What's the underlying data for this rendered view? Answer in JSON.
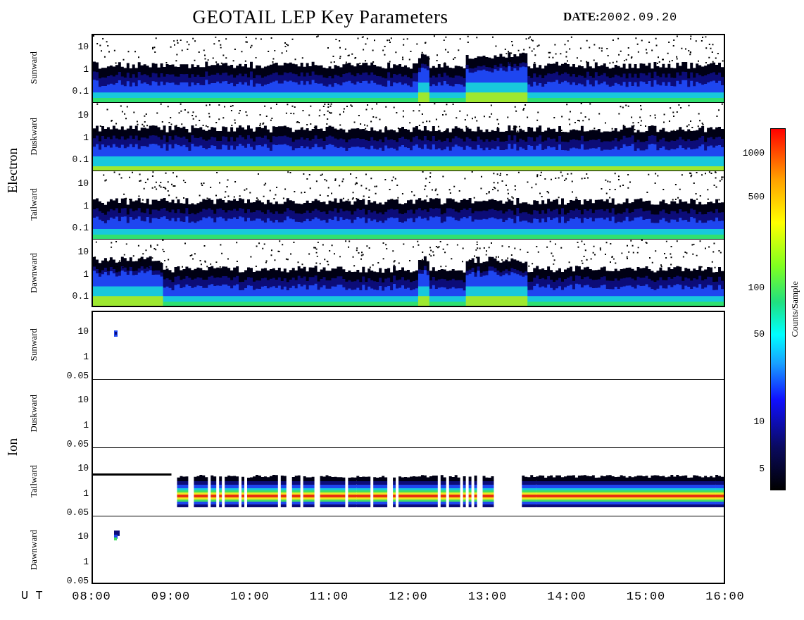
{
  "title": "GEOTAIL LEP Key Parameters",
  "date": {
    "label": "DATE:",
    "value": "2002.09.20"
  },
  "groups": [
    {
      "label": "Electron",
      "panels": [
        {
          "label": "Sunward",
          "kind": "dense",
          "yticks": [
            "10",
            "1",
            "0.1"
          ]
        },
        {
          "label": "Duskward",
          "kind": "dense",
          "yticks": [
            "10",
            "1",
            "0.1"
          ]
        },
        {
          "label": "Tailward",
          "kind": "dense",
          "yticks": [
            "10",
            "1",
            "0.1"
          ]
        },
        {
          "label": "Dawnward",
          "kind": "dense",
          "yticks": [
            "10",
            "1",
            "0.1"
          ]
        }
      ]
    },
    {
      "label": "Ion",
      "panels": [
        {
          "label": "Sunward",
          "kind": "blob",
          "yticks": [
            "10",
            "1",
            "0.05"
          ]
        },
        {
          "label": "Duskward",
          "kind": "empty",
          "yticks": [
            "10",
            "1",
            "0.05"
          ]
        },
        {
          "label": "Tailward",
          "kind": "band",
          "yticks": [
            "10",
            "1",
            "0.05"
          ]
        },
        {
          "label": "Dawnward",
          "kind": "blob",
          "yticks": [
            "10",
            "1",
            "0.05"
          ]
        }
      ]
    }
  ],
  "x_axis": {
    "label": "U T",
    "ticks": [
      "08:00",
      "09:00",
      "10:00",
      "11:00",
      "12:00",
      "13:00",
      "14:00",
      "15:00",
      "16:00"
    ]
  },
  "colorbar": {
    "label": "Counts/Sample",
    "ticks": [
      "1000",
      "500",
      "100",
      "50",
      "10",
      "5"
    ]
  }
}
